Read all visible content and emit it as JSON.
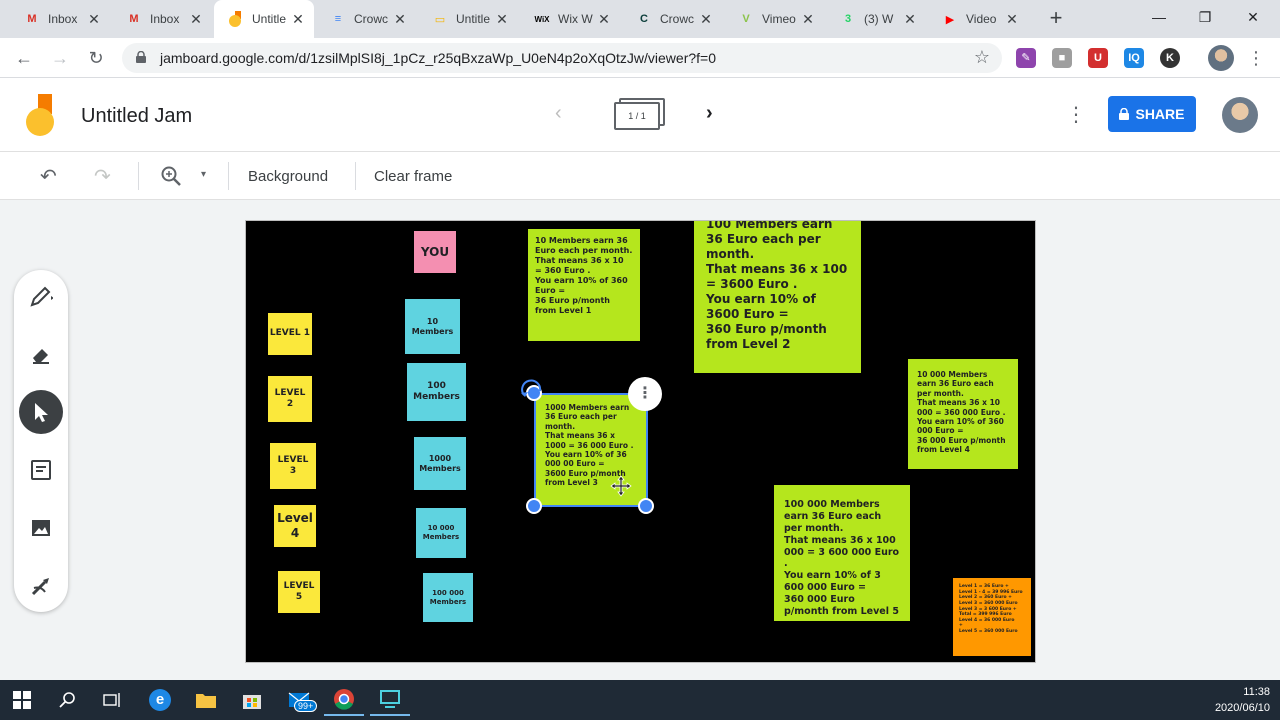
{
  "browser": {
    "tabs": [
      {
        "title": "Inbox",
        "icon": "gmail-icon",
        "color": "#d93025",
        "glyph": "M"
      },
      {
        "title": "Inbox",
        "icon": "gmail-icon",
        "color": "#d93025",
        "glyph": "M"
      },
      {
        "title": "Untitle",
        "icon": "jamboard-icon",
        "color": "#f9ab00",
        "glyph": ""
      },
      {
        "title": "Crowc",
        "icon": "docs-icon",
        "color": "#4285f4",
        "glyph": "≡"
      },
      {
        "title": "Untitle",
        "icon": "slides-icon",
        "color": "#f4b400",
        "glyph": "▭"
      },
      {
        "title": "Wix W",
        "icon": "wix-icon",
        "color": "#000000",
        "glyph": "WiX"
      },
      {
        "title": "Crowc",
        "icon": "crowdcast-icon",
        "color": "#0b3d3a",
        "glyph": "C"
      },
      {
        "title": "Vimeo",
        "icon": "vimeo-icon",
        "color": "#8bc34a",
        "glyph": "V"
      },
      {
        "title": "(3) W",
        "icon": "whatsapp-icon",
        "color": "#25d366",
        "glyph": "3"
      },
      {
        "title": "Video",
        "icon": "youtube-icon",
        "color": "#ff0000",
        "glyph": "▶"
      }
    ],
    "active_tab": 2,
    "url": "jamboard.google.com/d/1zsilMplSI8j_1pCz_r25qBxzaWp_U0eN4p2oXqOtzJw/viewer?f=0",
    "extensions": [
      {
        "name": "pen-extension-icon",
        "glyph": "✎",
        "color": "#8e44ad"
      },
      {
        "name": "puzzle-extension-icon",
        "glyph": "■",
        "color": "#9e9e9e"
      },
      {
        "name": "shield-extension-icon",
        "glyph": "U",
        "color": "#d32f2f"
      },
      {
        "name": "iq-extension-icon",
        "glyph": "IQ",
        "color": "#1e88e5"
      },
      {
        "name": "k-extension-icon",
        "glyph": "K",
        "color": "#333333"
      }
    ]
  },
  "jam": {
    "title": "Untitled Jam",
    "frame_indicator": "1 / 1",
    "share_label": "SHARE"
  },
  "toolbar": {
    "background_label": "Background",
    "clear_frame_label": "Clear frame"
  },
  "canvas": {
    "you_label": "YOU",
    "levels": [
      "LEVEL 1",
      "LEVEL\n2",
      "LEVEL\n3",
      "Level\n4",
      "LEVEL\n5"
    ],
    "members": [
      "10\nMembers",
      "100\nMembers",
      "1000\nMembers",
      "10 000\nMembers",
      "100 000\nMembers"
    ],
    "notes": {
      "level1": "10 Members earn 36 Euro each per month.\nThat means 36 x 10 = 360 Euro .\nYou earn 10% of 360 Euro =\n36 Euro p/month from Level 1",
      "level2": "100 Members earn 36 Euro each per month.\nThat means 36 x 100 = 3600 Euro .\nYou earn 10% of 3600 Euro =\n360 Euro p/month from Level 2",
      "level3": "1000 Members earn 36 Euro each per month.\nThat means 36 x 1000 = 36 000 Euro .\nYou earn 10% of 36 000 00 Euro =\n3600 Euro p/month from Level 3",
      "level4": "10 000 Members earn 36 Euro each per month.\nThat means 36 x 10 000 = 360 000 Euro .\nYou earn 10% of 360 000 Euro =\n36 000 Euro p/month from Level 4",
      "level5": "100 000 Members earn 36 Euro each per month.\nThat means 36 x 100 000 = 3 600 000 Euro .\nYou earn 10% of 3 600 000 Euro =\n360 000 Euro p/month from Level 5",
      "summary": "Level 1 = 36 Euro +\nLevel 1 - 4 = 39 996 Euro\nLevel 2 = 360 Euro +\nLevel 3 = 360 000 Euro\nLevel 3 = 3 600 Euro +\nTotal = 399 996 Euro\nLevel 4 = 36 000 Euro\n+\nLevel 5 = 360 000 Euro"
    }
  },
  "taskbar": {
    "notification_badge": "99+",
    "time": "11:38",
    "date": "2020/06/10"
  }
}
